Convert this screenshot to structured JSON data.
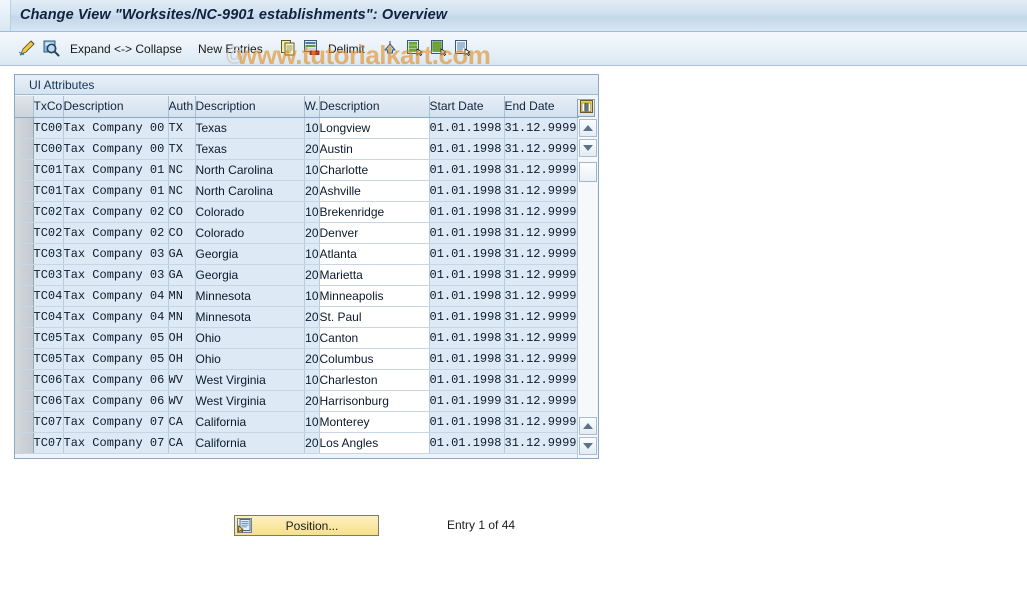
{
  "window": {
    "title": "Change View \"Worksites/NC-9901 establishments\": Overview"
  },
  "toolbar": {
    "expand_collapse_label": "Expand <-> Collapse",
    "new_entries_label": "New Entries",
    "delimit_label": "Delimit",
    "icons": [
      "pencil-display-change-icon",
      "magnifier-details-icon",
      "copy-icon",
      "delete-icon",
      "undo-icon",
      "select-all-icon",
      "deselect-all-icon",
      "select-block-icon"
    ]
  },
  "watermark": {
    "text": "www.tutorialkart.com",
    "at_symbol": "@"
  },
  "panel": {
    "title": "UI Attributes"
  },
  "table": {
    "columns": [
      {
        "key": "sel",
        "label": ""
      },
      {
        "key": "txco",
        "label": "TxCo"
      },
      {
        "key": "desc1",
        "label": "Description"
      },
      {
        "key": "auth",
        "label": "Auth"
      },
      {
        "key": "desc2",
        "label": "Description"
      },
      {
        "key": "w",
        "label": "W."
      },
      {
        "key": "desc3",
        "label": "Description"
      },
      {
        "key": "sdate",
        "label": "Start Date"
      },
      {
        "key": "edate",
        "label": "End Date"
      }
    ],
    "config_icon": "table-settings-icon",
    "rows": [
      {
        "txco": "TC00",
        "desc1": "Tax Company 00",
        "auth": "TX",
        "desc2": "Texas",
        "w": "10",
        "desc3": "Longview",
        "sdate": "01.01.1998",
        "edate": "31.12.9999"
      },
      {
        "txco": "TC00",
        "desc1": "Tax Company 00",
        "auth": "TX",
        "desc2": "Texas",
        "w": "20",
        "desc3": "Austin",
        "sdate": "01.01.1998",
        "edate": "31.12.9999"
      },
      {
        "txco": "TC01",
        "desc1": "Tax Company 01",
        "auth": "NC",
        "desc2": "North Carolina",
        "w": "10",
        "desc3": "Charlotte",
        "sdate": "01.01.1998",
        "edate": "31.12.9999"
      },
      {
        "txco": "TC01",
        "desc1": "Tax Company 01",
        "auth": "NC",
        "desc2": "North Carolina",
        "w": "20",
        "desc3": "Ashville",
        "sdate": "01.01.1998",
        "edate": "31.12.9999"
      },
      {
        "txco": "TC02",
        "desc1": "Tax Company 02",
        "auth": "CO",
        "desc2": "Colorado",
        "w": "10",
        "desc3": "Brekenridge",
        "sdate": "01.01.1998",
        "edate": "31.12.9999"
      },
      {
        "txco": "TC02",
        "desc1": "Tax Company 02",
        "auth": "CO",
        "desc2": "Colorado",
        "w": "20",
        "desc3": "Denver",
        "sdate": "01.01.1998",
        "edate": "31.12.9999"
      },
      {
        "txco": "TC03",
        "desc1": "Tax Company 03",
        "auth": "GA",
        "desc2": "Georgia",
        "w": "10",
        "desc3": "Atlanta",
        "sdate": "01.01.1998",
        "edate": "31.12.9999"
      },
      {
        "txco": "TC03",
        "desc1": "Tax Company 03",
        "auth": "GA",
        "desc2": "Georgia",
        "w": "20",
        "desc3": "Marietta",
        "sdate": "01.01.1998",
        "edate": "31.12.9999"
      },
      {
        "txco": "TC04",
        "desc1": "Tax Company 04",
        "auth": "MN",
        "desc2": "Minnesota",
        "w": "10",
        "desc3": "Minneapolis",
        "sdate": "01.01.1998",
        "edate": "31.12.9999"
      },
      {
        "txco": "TC04",
        "desc1": "Tax Company 04",
        "auth": "MN",
        "desc2": "Minnesota",
        "w": "20",
        "desc3": "St. Paul",
        "sdate": "01.01.1998",
        "edate": "31.12.9999"
      },
      {
        "txco": "TC05",
        "desc1": "Tax Company 05",
        "auth": "OH",
        "desc2": "Ohio",
        "w": "10",
        "desc3": "Canton",
        "sdate": "01.01.1998",
        "edate": "31.12.9999"
      },
      {
        "txco": "TC05",
        "desc1": "Tax Company 05",
        "auth": "OH",
        "desc2": "Ohio",
        "w": "20",
        "desc3": "Columbus",
        "sdate": "01.01.1998",
        "edate": "31.12.9999"
      },
      {
        "txco": "TC06",
        "desc1": "Tax Company 06",
        "auth": "WV",
        "desc2": "West Virginia",
        "w": "10",
        "desc3": "Charleston",
        "sdate": "01.01.1998",
        "edate": "31.12.9999"
      },
      {
        "txco": "TC06",
        "desc1": "Tax Company 06",
        "auth": "WV",
        "desc2": "West Virginia",
        "w": "20",
        "desc3": "Harrisonburg",
        "sdate": "01.01.1999",
        "edate": "31.12.9999"
      },
      {
        "txco": "TC07",
        "desc1": "Tax Company 07",
        "auth": "CA",
        "desc2": "California",
        "w": "10",
        "desc3": "Monterey",
        "sdate": "01.01.1998",
        "edate": "31.12.9999"
      },
      {
        "txco": "TC07",
        "desc1": "Tax Company 07",
        "auth": "CA",
        "desc2": "California",
        "w": "20",
        "desc3": "Los Angles",
        "sdate": "01.01.1998",
        "edate": "31.12.9999"
      }
    ]
  },
  "scrollbar": {
    "up_icon": "scroll-up-icon",
    "down_icon": "scroll-down-icon",
    "page_up_icon": "scroll-page-up-icon",
    "page_down_icon": "scroll-page-down-icon"
  },
  "footer": {
    "position_label": "Position...",
    "position_icon": "position-icon",
    "entry_status": "Entry 1 of 44"
  },
  "colors": {
    "title_bg": "#cfe0f0",
    "row_shade": "#dde9f4",
    "row_white": "#ffffff",
    "button_yellow": "#f7e08a",
    "watermark": "#e28e24"
  }
}
